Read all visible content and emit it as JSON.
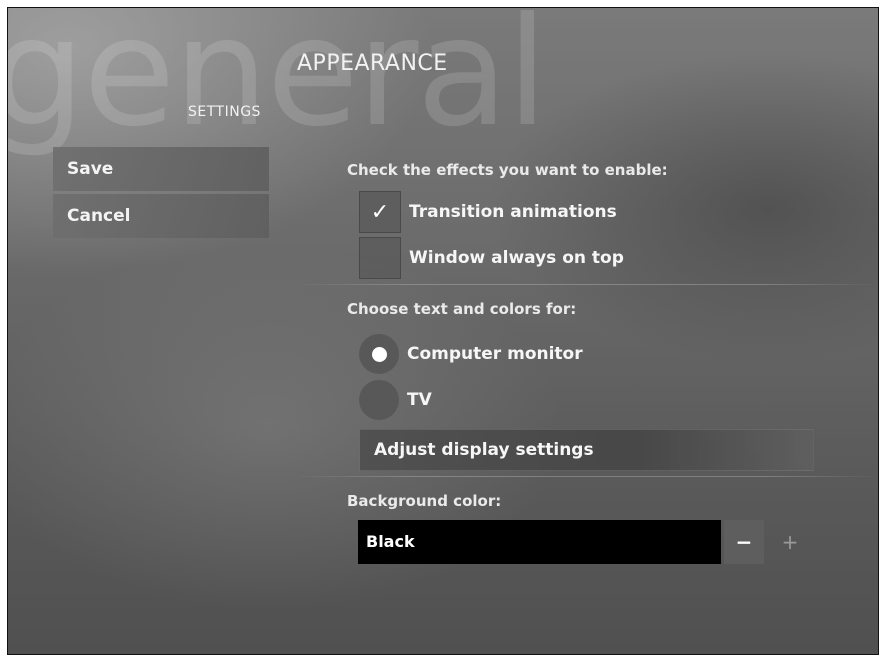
{
  "background_word": "general",
  "header": {
    "title": "APPEARANCE",
    "subtitle": "SETTINGS"
  },
  "left_menu": {
    "items": [
      {
        "label": "Save"
      },
      {
        "label": "Cancel"
      }
    ]
  },
  "effects": {
    "label": "Check the effects you want to enable:",
    "options": [
      {
        "label": "Transition animations",
        "checked": true,
        "check_glyph": "✓"
      },
      {
        "label": "Window always on top",
        "checked": false
      }
    ]
  },
  "colors_for": {
    "label": "Choose text and colors for:",
    "options": [
      {
        "label": "Computer monitor",
        "selected": true
      },
      {
        "label": "TV",
        "selected": false
      }
    ],
    "adjust_button": "Adjust display settings"
  },
  "background_color": {
    "label": "Background color:",
    "value": "Black",
    "minus": "−",
    "plus": "+"
  }
}
